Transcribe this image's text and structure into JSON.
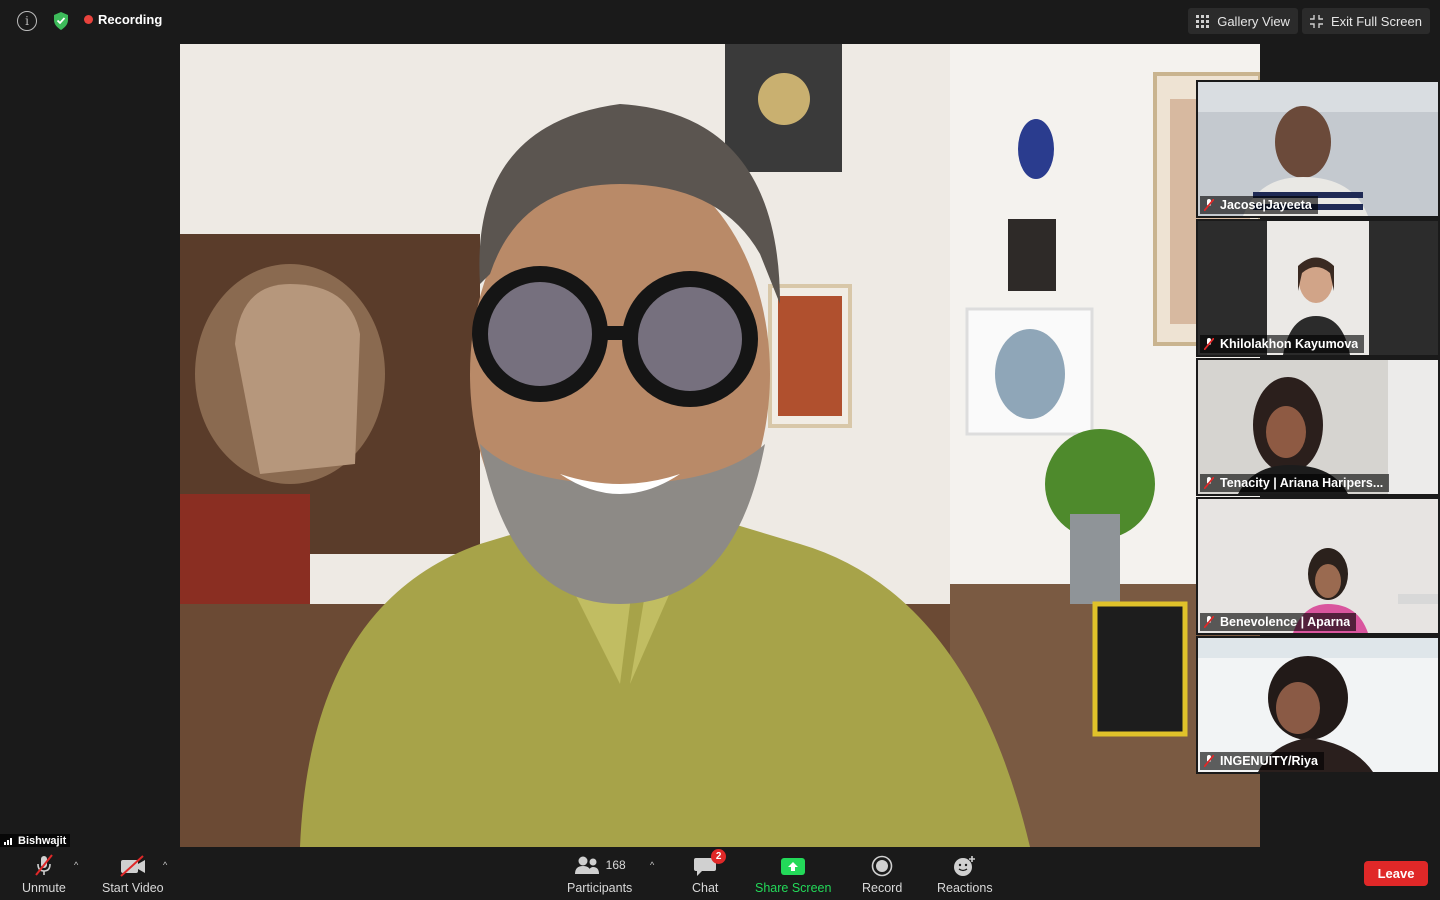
{
  "topbar": {
    "recording_label": "Recording",
    "gallery_view_label": "Gallery View",
    "exit_fullscreen_label": "Exit Full Screen"
  },
  "active_speaker": {
    "name_tag": "Bishwajit"
  },
  "participants_tiles": [
    {
      "name": "Jacose|Jayeeta",
      "muted": true
    },
    {
      "name": "Khilolakhon Kayumova",
      "muted": true
    },
    {
      "name": "Tenacity | Ariana Haripers...",
      "muted": true
    },
    {
      "name": "Benevolence | Aparna",
      "muted": true
    },
    {
      "name": "INGENUITY/Riya",
      "muted": true
    }
  ],
  "toolbar": {
    "unmute_label": "Unmute",
    "start_video_label": "Start Video",
    "participants_label": "Participants",
    "participants_count": "168",
    "chat_label": "Chat",
    "chat_badge": "2",
    "share_screen_label": "Share Screen",
    "record_label": "Record",
    "reactions_label": "Reactions",
    "leave_label": "Leave"
  },
  "colors": {
    "share_screen_green": "#23d959",
    "leave_red": "#e02828",
    "recording_red": "#e8433d",
    "shield_green": "#3dbb5a"
  }
}
